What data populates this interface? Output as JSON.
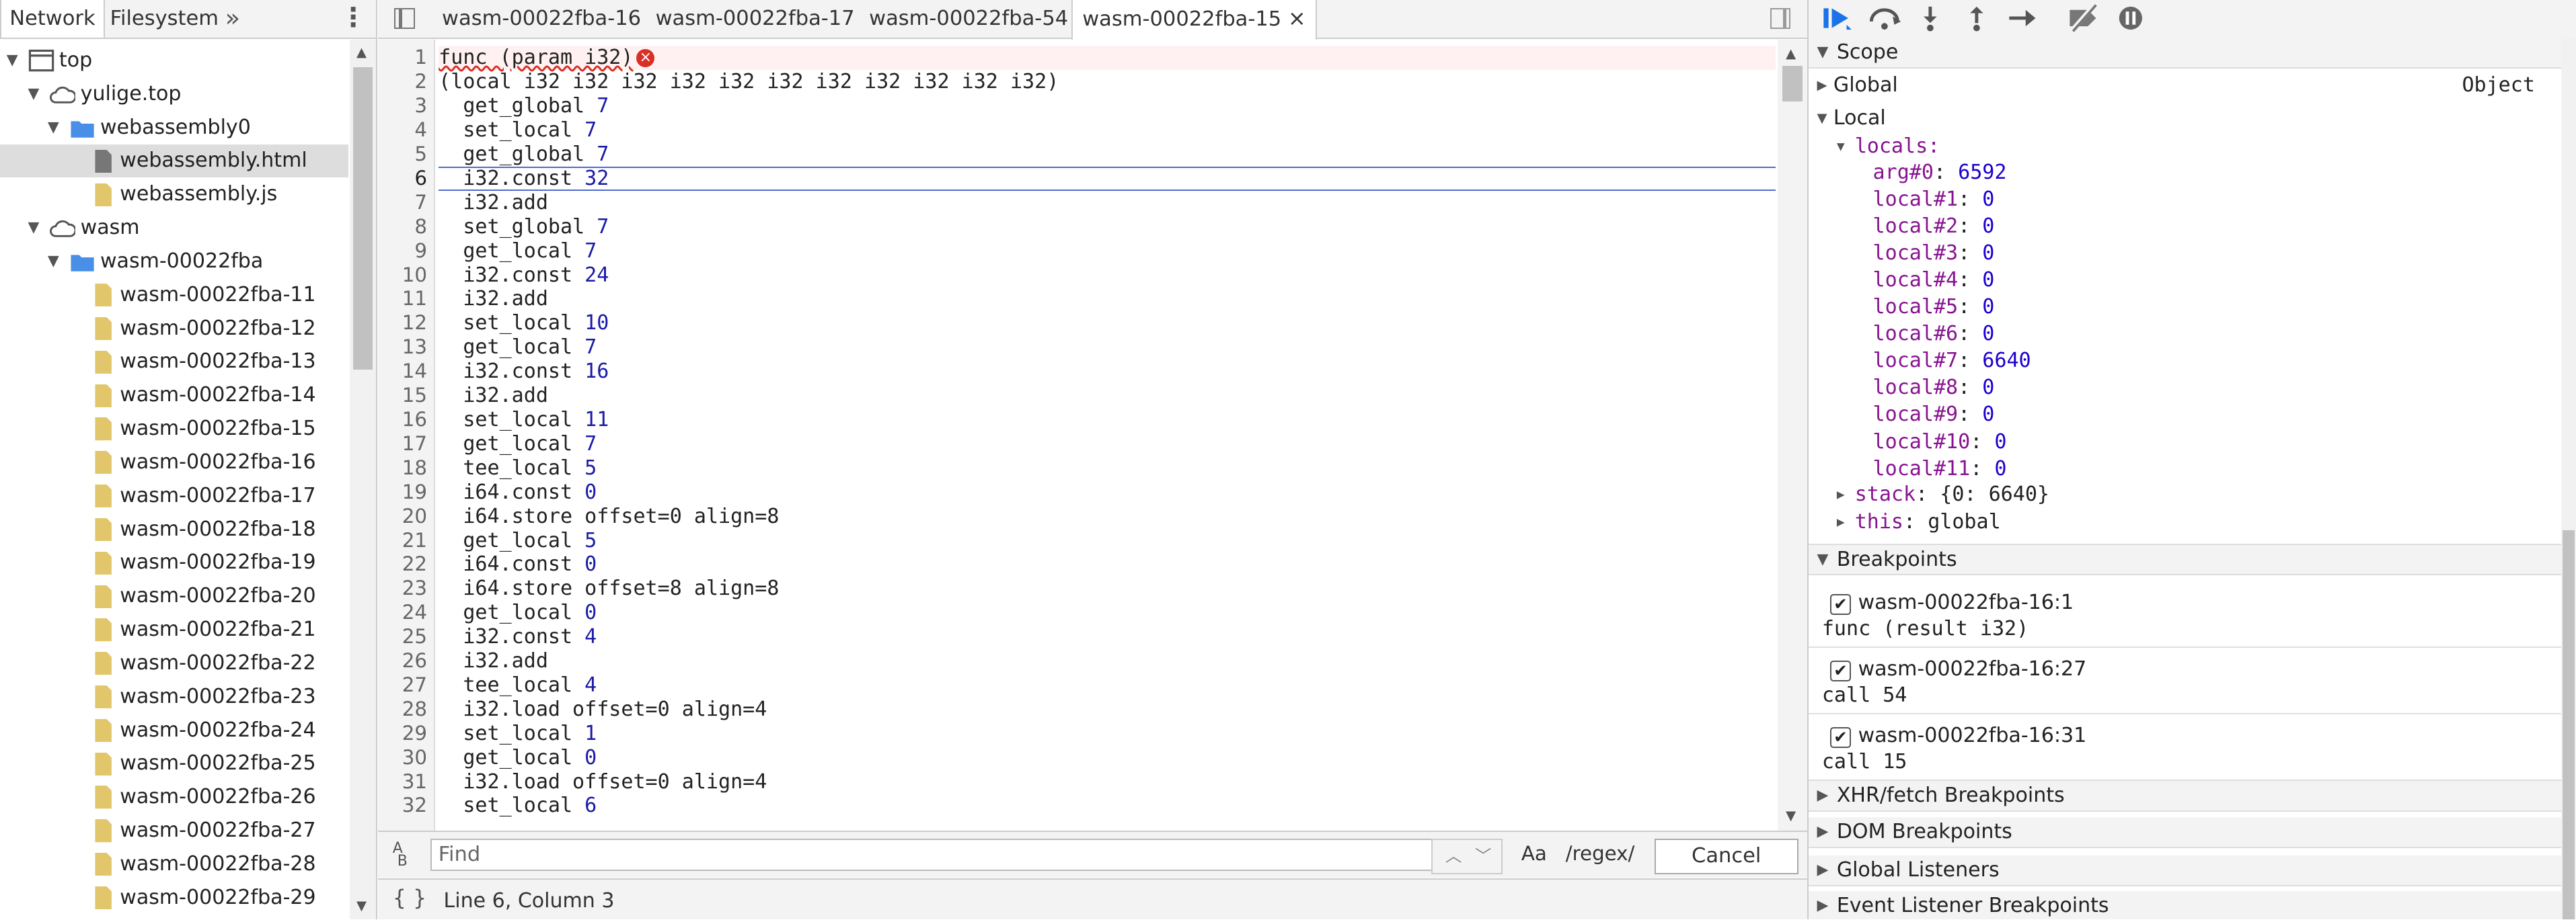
{
  "navigator": {
    "tabs": [
      "Network",
      "Filesystem"
    ],
    "more": "»",
    "menu": "⋮",
    "tree": [
      {
        "label": "top",
        "type": "frame",
        "level": 0
      },
      {
        "label": "yulige.top",
        "type": "cloud",
        "level": 1
      },
      {
        "label": "webassembly0",
        "type": "folder",
        "level": 2
      },
      {
        "label": "webassembly.html",
        "type": "file-gray",
        "level": 3,
        "selected": true
      },
      {
        "label": "webassembly.js",
        "type": "file",
        "level": 3
      },
      {
        "label": "wasm",
        "type": "cloud",
        "level": 1
      },
      {
        "label": "wasm-00022fba",
        "type": "folder",
        "level": 2
      },
      {
        "label": "wasm-00022fba-11",
        "type": "file",
        "level": 3
      },
      {
        "label": "wasm-00022fba-12",
        "type": "file",
        "level": 3
      },
      {
        "label": "wasm-00022fba-13",
        "type": "file",
        "level": 3
      },
      {
        "label": "wasm-00022fba-14",
        "type": "file",
        "level": 3
      },
      {
        "label": "wasm-00022fba-15",
        "type": "file",
        "level": 3
      },
      {
        "label": "wasm-00022fba-16",
        "type": "file",
        "level": 3
      },
      {
        "label": "wasm-00022fba-17",
        "type": "file",
        "level": 3
      },
      {
        "label": "wasm-00022fba-18",
        "type": "file",
        "level": 3
      },
      {
        "label": "wasm-00022fba-19",
        "type": "file",
        "level": 3
      },
      {
        "label": "wasm-00022fba-20",
        "type": "file",
        "level": 3
      },
      {
        "label": "wasm-00022fba-21",
        "type": "file",
        "level": 3
      },
      {
        "label": "wasm-00022fba-22",
        "type": "file",
        "level": 3
      },
      {
        "label": "wasm-00022fba-23",
        "type": "file",
        "level": 3
      },
      {
        "label": "wasm-00022fba-24",
        "type": "file",
        "level": 3
      },
      {
        "label": "wasm-00022fba-25",
        "type": "file",
        "level": 3
      },
      {
        "label": "wasm-00022fba-26",
        "type": "file",
        "level": 3
      },
      {
        "label": "wasm-00022fba-27",
        "type": "file",
        "level": 3
      },
      {
        "label": "wasm-00022fba-28",
        "type": "file",
        "level": 3
      },
      {
        "label": "wasm-00022fba-29",
        "type": "file",
        "level": 3
      }
    ]
  },
  "editor": {
    "tabs": [
      {
        "label": "wasm-00022fba-16",
        "active": false
      },
      {
        "label": "wasm-00022fba-17",
        "active": false
      },
      {
        "label": "wasm-00022fba-54",
        "active": false
      },
      {
        "label": "wasm-00022fba-15",
        "active": true,
        "close": "×"
      }
    ],
    "current_line": 6,
    "error_line": 1,
    "lines": [
      {
        "n": "1",
        "op": "func (param i32)",
        "arg": ""
      },
      {
        "n": "2",
        "op": "(local i32 i32 i32 i32 i32 i32 i32 i32 i32 i32 i32)",
        "arg": ""
      },
      {
        "n": "3",
        "op": "  get_global ",
        "arg": "7"
      },
      {
        "n": "4",
        "op": "  set_local ",
        "arg": "7"
      },
      {
        "n": "5",
        "op": "  get_global ",
        "arg": "7"
      },
      {
        "n": "6",
        "op": "  i32.const ",
        "arg": "32"
      },
      {
        "n": "7",
        "op": "  i32.add",
        "arg": ""
      },
      {
        "n": "8",
        "op": "  set_global ",
        "arg": "7"
      },
      {
        "n": "9",
        "op": "  get_local ",
        "arg": "7"
      },
      {
        "n": "10",
        "op": "  i32.const ",
        "arg": "24"
      },
      {
        "n": "11",
        "op": "  i32.add",
        "arg": ""
      },
      {
        "n": "12",
        "op": "  set_local ",
        "arg": "10"
      },
      {
        "n": "13",
        "op": "  get_local ",
        "arg": "7"
      },
      {
        "n": "14",
        "op": "  i32.const ",
        "arg": "16"
      },
      {
        "n": "15",
        "op": "  i32.add",
        "arg": ""
      },
      {
        "n": "16",
        "op": "  set_local ",
        "arg": "11"
      },
      {
        "n": "17",
        "op": "  get_local ",
        "arg": "7"
      },
      {
        "n": "18",
        "op": "  tee_local ",
        "arg": "5"
      },
      {
        "n": "19",
        "op": "  i64.const ",
        "arg": "0"
      },
      {
        "n": "20",
        "op": "  i64.store offset=0 align=8",
        "arg": ""
      },
      {
        "n": "21",
        "op": "  get_local ",
        "arg": "5"
      },
      {
        "n": "22",
        "op": "  i64.const ",
        "arg": "0"
      },
      {
        "n": "23",
        "op": "  i64.store offset=8 align=8",
        "arg": ""
      },
      {
        "n": "24",
        "op": "  get_local ",
        "arg": "0"
      },
      {
        "n": "25",
        "op": "  i32.const ",
        "arg": "4"
      },
      {
        "n": "26",
        "op": "  i32.add",
        "arg": ""
      },
      {
        "n": "27",
        "op": "  tee_local ",
        "arg": "4"
      },
      {
        "n": "28",
        "op": "  i32.load offset=0 align=4",
        "arg": ""
      },
      {
        "n": "29",
        "op": "  set_local ",
        "arg": "1"
      },
      {
        "n": "30",
        "op": "  get_local ",
        "arg": "0"
      },
      {
        "n": "31",
        "op": "  i32.load offset=0 align=4",
        "arg": ""
      },
      {
        "n": "32",
        "op": "  set_local ",
        "arg": "6"
      }
    ],
    "find": {
      "placeholder": "Find",
      "match_case": "Aa",
      "regex": "/regex/",
      "cancel": "Cancel"
    },
    "status": {
      "pretty_print": "{ }",
      "cursor": "Line 6, Column 3"
    }
  },
  "debugger": {
    "scope_title": "Scope",
    "global": {
      "label": "Global",
      "value": "Object"
    },
    "local_title": "Local",
    "locals_title": "locals:",
    "locals": [
      {
        "k": "arg#0",
        "v": "6592"
      },
      {
        "k": "local#1",
        "v": "0"
      },
      {
        "k": "local#2",
        "v": "0"
      },
      {
        "k": "local#3",
        "v": "0"
      },
      {
        "k": "local#4",
        "v": "0"
      },
      {
        "k": "local#5",
        "v": "0"
      },
      {
        "k": "local#6",
        "v": "0"
      },
      {
        "k": "local#7",
        "v": "6640"
      },
      {
        "k": "local#8",
        "v": "0"
      },
      {
        "k": "local#9",
        "v": "0"
      },
      {
        "k": "local#10",
        "v": "0"
      },
      {
        "k": "local#11",
        "v": "0"
      }
    ],
    "stack": {
      "k": "stack",
      "v": "{0: 6640}"
    },
    "this": {
      "k": "this",
      "v": "global"
    },
    "breakpoints_title": "Breakpoints",
    "breakpoints": [
      {
        "name": "wasm-00022fba-16:1",
        "code": "func (result i32)"
      },
      {
        "name": "wasm-00022fba-16:27",
        "code": "call 54"
      },
      {
        "name": "wasm-00022fba-16:31",
        "code": "call 15"
      }
    ],
    "sections": [
      "XHR/fetch Breakpoints",
      "DOM Breakpoints",
      "Global Listeners",
      "Event Listener Breakpoints"
    ]
  },
  "colors": {
    "accent": "#1a73e8",
    "number": "#1a1aa6",
    "key": "#881391",
    "value": "#1c00cf",
    "folder": "#4a8fe7",
    "file": "#e2c66b"
  }
}
